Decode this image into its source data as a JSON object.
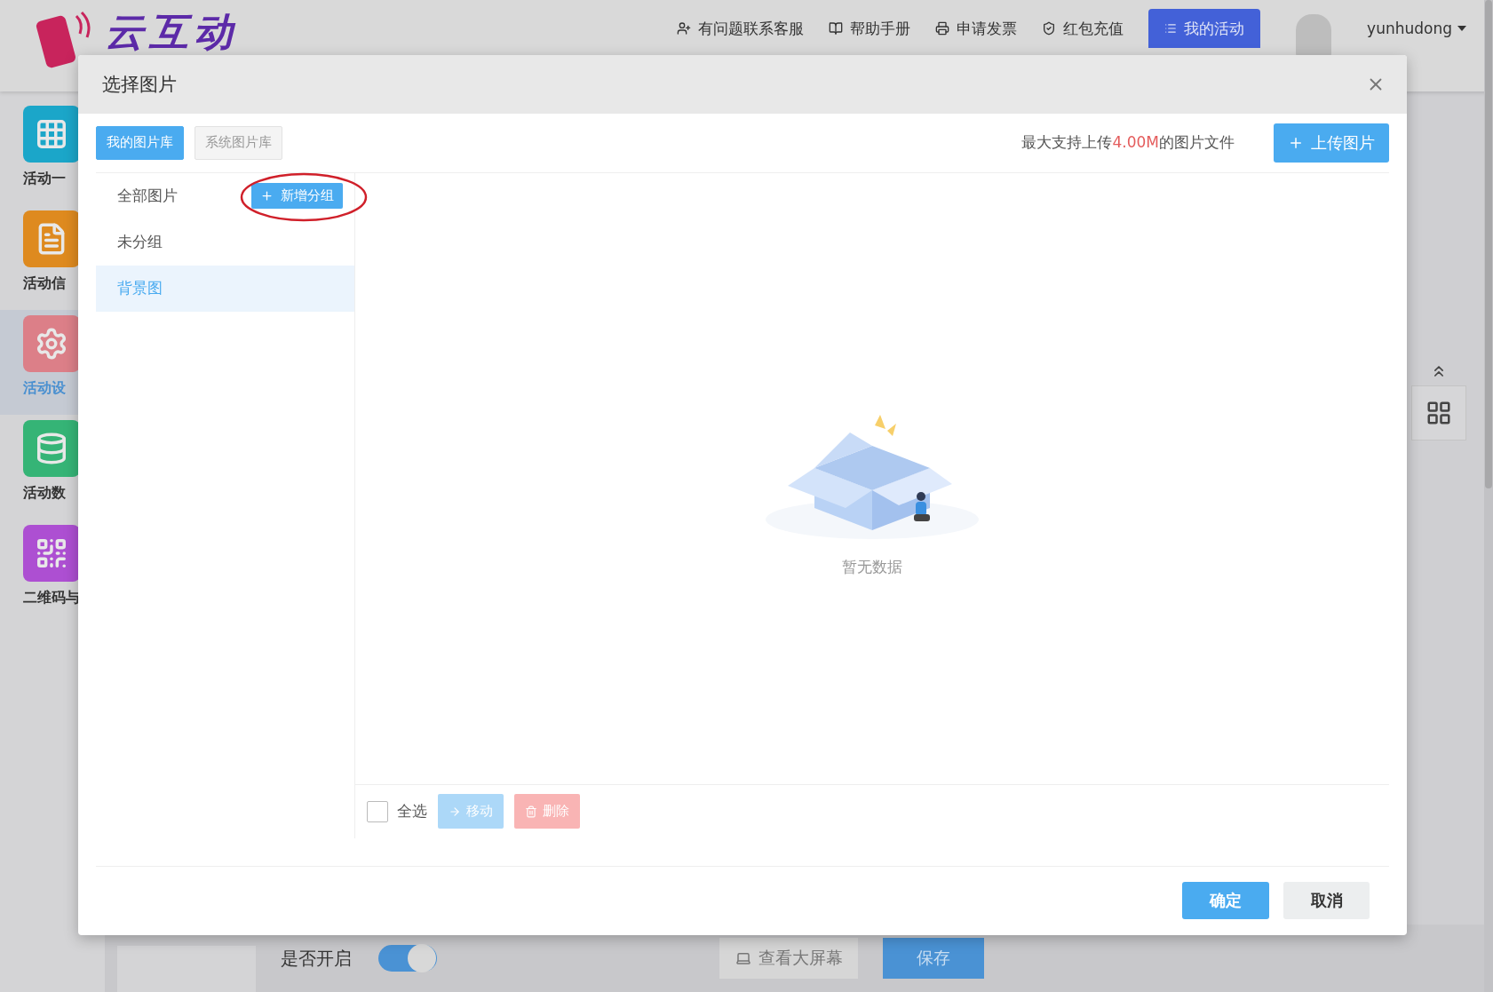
{
  "header": {
    "logo_text": "云互动",
    "nav_links": [
      {
        "kind": "support",
        "label": "有问题联系客服"
      },
      {
        "kind": "manual",
        "label": "帮助手册"
      },
      {
        "kind": "invoice",
        "label": "申请发票"
      },
      {
        "kind": "recharge",
        "label": "红包充值"
      }
    ],
    "my_activity_button": "我的活动",
    "username": "yunhudong"
  },
  "sidebar": {
    "items": [
      {
        "kind": "grid",
        "label": "活动一",
        "color": "#1ba6c9",
        "selected": false
      },
      {
        "kind": "doc",
        "label": "活动信",
        "color": "#de8a1f",
        "selected": false
      },
      {
        "kind": "gear",
        "label": "活动设",
        "color": "#dc7f88",
        "selected": true
      },
      {
        "kind": "data",
        "label": "活动数",
        "color": "#35b476",
        "selected": false
      },
      {
        "kind": "qr",
        "label": "二维码与",
        "color": "#ad4fd2",
        "selected": false
      }
    ]
  },
  "bottom_bar": {
    "toggle": {
      "label": "是否开启",
      "on": true
    },
    "view_screen_button": "查看大屏幕",
    "save_button": "保存"
  },
  "modal": {
    "title": "选择图片",
    "tabs": [
      {
        "label": "我的图片库",
        "selected": true
      },
      {
        "label": "系统图片库",
        "selected": false
      }
    ],
    "upload_hint": {
      "before": "最大支持上传",
      "size": "4.00M",
      "after": "的图片文件"
    },
    "upload_button": "上传图片",
    "groups": [
      {
        "label": "全部图片",
        "selected": false
      },
      {
        "label": "未分组",
        "selected": false
      },
      {
        "label": "背景图",
        "selected": true
      }
    ],
    "add_group_button": "新增分组",
    "empty_text": "暂无数据",
    "select_all": {
      "label": "全选",
      "checked": false
    },
    "move_button": {
      "label": "移动",
      "disabled": true
    },
    "delete_button": {
      "label": "删除",
      "disabled": true
    },
    "confirm_button": "确定",
    "cancel_button": "取消"
  }
}
